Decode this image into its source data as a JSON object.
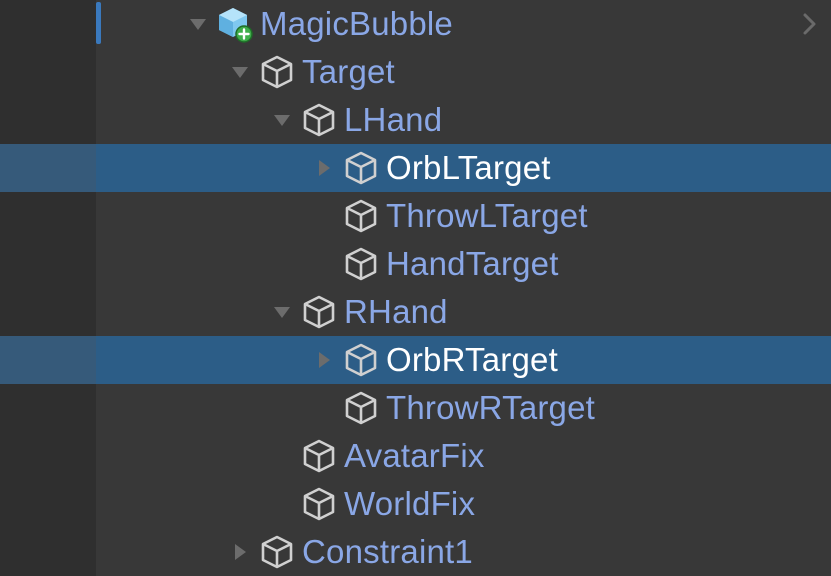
{
  "hierarchy": {
    "items": [
      {
        "label": "MagicBubble",
        "depth": 0,
        "arrow": "expanded",
        "icon": "prefab-variant-icon",
        "selected": false
      },
      {
        "label": "Target",
        "depth": 1,
        "arrow": "expanded",
        "icon": "gameobject-icon",
        "selected": false
      },
      {
        "label": "LHand",
        "depth": 2,
        "arrow": "expanded",
        "icon": "gameobject-icon",
        "selected": false
      },
      {
        "label": "OrbLTarget",
        "depth": 3,
        "arrow": "collapsed",
        "icon": "gameobject-icon",
        "selected": true
      },
      {
        "label": "ThrowLTarget",
        "depth": 3,
        "arrow": "none",
        "icon": "gameobject-icon",
        "selected": false
      },
      {
        "label": "HandTarget",
        "depth": 3,
        "arrow": "none",
        "icon": "gameobject-icon",
        "selected": false
      },
      {
        "label": "RHand",
        "depth": 2,
        "arrow": "expanded",
        "icon": "gameobject-icon",
        "selected": false
      },
      {
        "label": "OrbRTarget",
        "depth": 3,
        "arrow": "collapsed",
        "icon": "gameobject-icon",
        "selected": true
      },
      {
        "label": "ThrowRTarget",
        "depth": 3,
        "arrow": "none",
        "icon": "gameobject-icon",
        "selected": false
      },
      {
        "label": "AvatarFix",
        "depth": 2,
        "arrow": "none",
        "icon": "gameobject-icon",
        "selected": false
      },
      {
        "label": "WorldFix",
        "depth": 2,
        "arrow": "none",
        "icon": "gameobject-icon",
        "selected": false
      },
      {
        "label": "Constraint1",
        "depth": 1,
        "arrow": "collapsed",
        "icon": "gameobject-icon",
        "selected": false
      }
    ]
  },
  "scroll_indicator_icon": "chevron-right-icon",
  "colors": {
    "background": "#383838",
    "label": "#8aa7e6",
    "selected_row": "#2c5d87",
    "selected_label": "#ffffff",
    "accent": "#3a79bd"
  }
}
